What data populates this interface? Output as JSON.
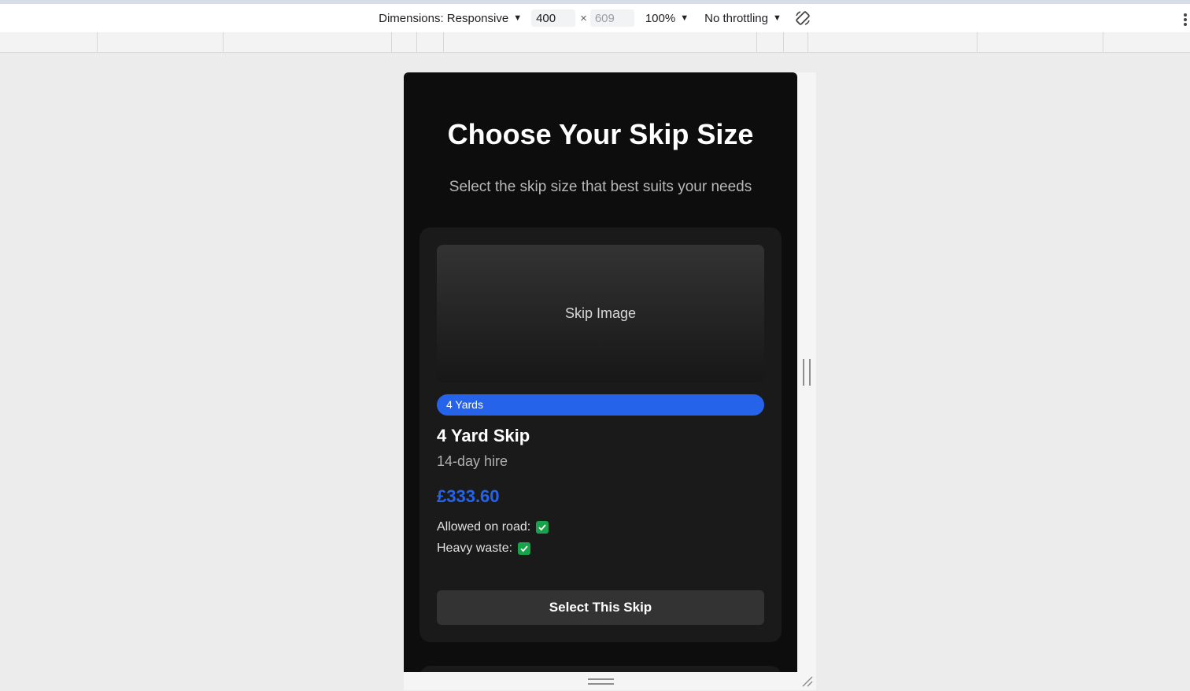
{
  "devtools": {
    "dimensions_label": "Dimensions: Responsive",
    "width_value": "400",
    "height_value": "609",
    "times_symbol": "×",
    "zoom_label": "100%",
    "throttle_label": "No throttling",
    "caret": "▼"
  },
  "page": {
    "title": "Choose Your Skip Size",
    "subtitle": "Select the skip size that best suits your needs"
  },
  "card": {
    "image_placeholder": "Skip Image",
    "badge": "4 Yards",
    "name": "4 Yard Skip",
    "hire_period": "14-day hire",
    "price": "£333.60",
    "road_label": "Allowed on road:",
    "heavy_label": "Heavy waste:",
    "button_label": "Select This Skip"
  },
  "colors": {
    "accent": "#2563eb",
    "check": "#16a34a",
    "background": "#0d0d0d",
    "card": "#1a1a1a"
  },
  "icons": [
    "rotate-icon",
    "more-icon",
    "check-icon",
    "resize-handle-icon"
  ]
}
